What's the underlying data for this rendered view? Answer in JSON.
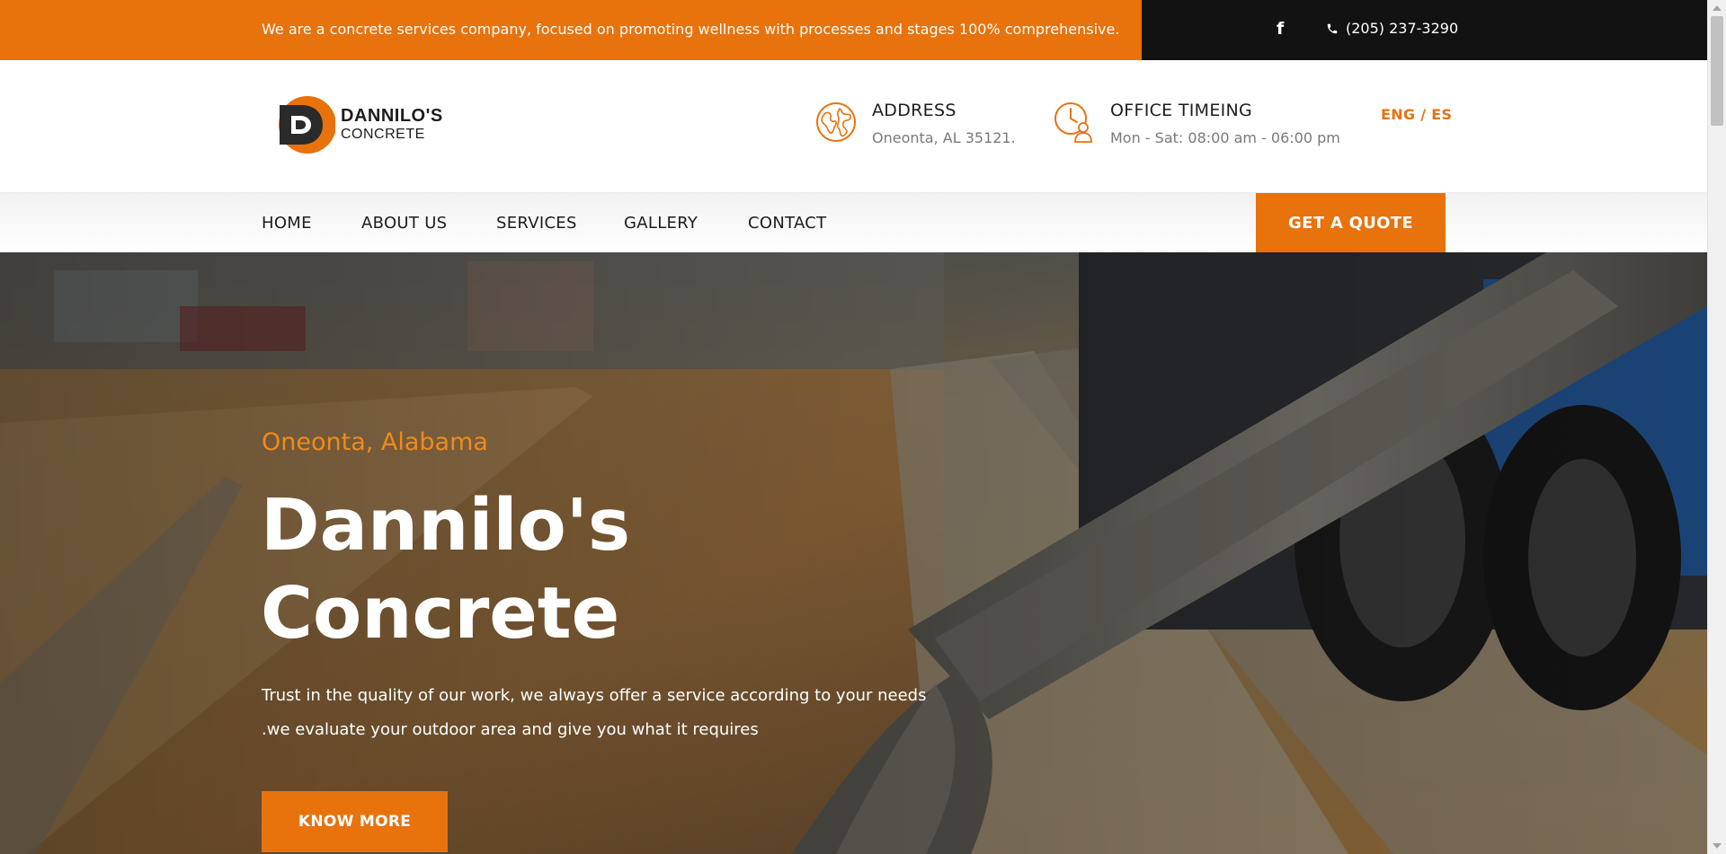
{
  "topbar": {
    "message": "We are a concrete services company, focused on promoting wellness with processes and stages 100% comprehensive.",
    "facebook_icon": "facebook-icon",
    "phone_icon": "phone-icon",
    "phone": "(205) 237-3290"
  },
  "header": {
    "logo": {
      "line1": "DANNILO'S",
      "line2": "CONCRETE"
    },
    "address": {
      "icon": "globe-icon",
      "title": "ADDRESS",
      "value": "Oneonta, AL 35121."
    },
    "office": {
      "icon": "clock-person-icon",
      "title": "OFFICE TIMEING",
      "value": "Mon - Sat: 08:00 am - 06:00 pm"
    },
    "language": "ENG / ES"
  },
  "nav": {
    "items": [
      "HOME",
      "ABOUT US",
      "SERVICES",
      "GALLERY",
      "CONTACT"
    ],
    "cta": "GET A QUOTE"
  },
  "hero": {
    "location": "Oneonta, Alabama",
    "title_line1": "Dannilo's",
    "title_line2": "Concrete",
    "desc_line1": "Trust in the quality of our work, we always offer a service according to your needs",
    "desc_line2": ".we evaluate your outdoor area and give you what it requires",
    "button": "KNOW MORE"
  },
  "colors": {
    "accent": "#e8720c",
    "dark": "#121212"
  }
}
